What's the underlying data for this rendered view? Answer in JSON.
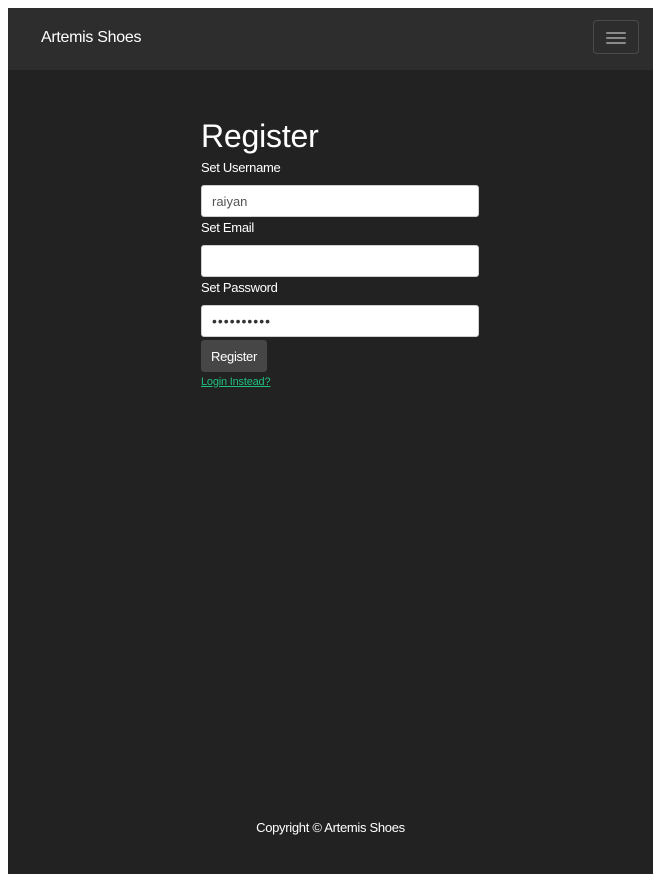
{
  "navbar": {
    "brand": "Artemis Shoes",
    "toggler_icon": "hamburger-menu-icon"
  },
  "form": {
    "title": "Register",
    "username": {
      "label": "Set Username",
      "value": "raiyan"
    },
    "email": {
      "label": "Set Email",
      "value": ""
    },
    "password": {
      "label": "Set Password",
      "value": "••••••••••"
    },
    "submit_label": "Register",
    "login_link": "Login Instead?"
  },
  "footer": {
    "copyright": "Copyright © Artemis Shoes"
  },
  "colors": {
    "page_background": "#222222",
    "navbar_background": "#2d2d2d",
    "button_background": "#464646",
    "link": "#1fbf7e"
  }
}
